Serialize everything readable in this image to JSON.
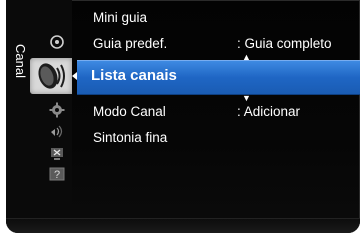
{
  "sidebar": {
    "section_title": "Canal",
    "icons": [
      "globe-icon",
      "satellite-dish-icon",
      "gear-icon",
      "sound-icon",
      "input-icon",
      "help-icon"
    ],
    "active_index": 1
  },
  "menu": {
    "items": [
      {
        "label": "Mini guia",
        "value": ""
      },
      {
        "label": "Guia predef.",
        "value": ": Guia completo"
      },
      {
        "label": "Lista canais",
        "value": "",
        "selected": true
      },
      {
        "label": "Modo Canal",
        "value": ": Adicionar"
      },
      {
        "label": "Sintonia fina",
        "value": ""
      }
    ]
  },
  "colors": {
    "background": "#050505",
    "highlight": "#2a73d3",
    "text": "#ffffff"
  }
}
